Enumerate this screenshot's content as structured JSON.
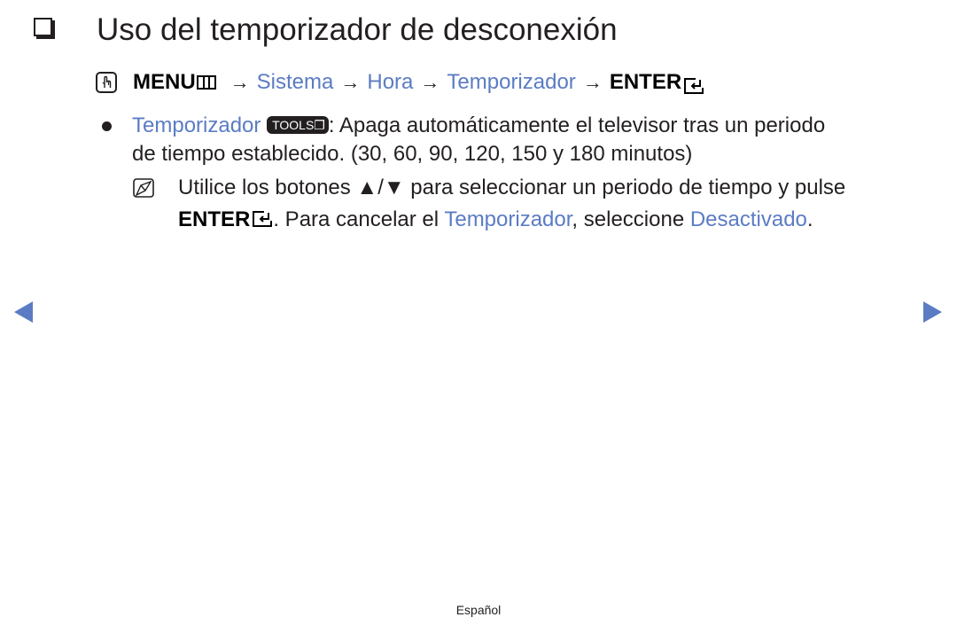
{
  "page": {
    "title": "Uso del temporizador de desconexión",
    "language": "Español"
  },
  "menu_path": {
    "menu_label": "MENU",
    "steps": [
      "Sistema",
      "Hora",
      "Temporizador"
    ],
    "enter_label": "ENTER",
    "arrow": "→"
  },
  "bullet": {
    "term": "Temporizador",
    "tools_label": "TOOLS",
    "line1": ": Apaga automáticamente el televisor tras un periodo",
    "line2": "de tiempo establecido. (30, 60, 90, 120, 150 y 180 minutos)"
  },
  "note": {
    "line1": "Utilice los botones ▲/▼ para seleccionar un periodo de tiempo y pulse",
    "enter_label": "ENTER",
    "line2_a": ". Para cancelar el ",
    "line2_term": "Temporizador",
    "line2_b": ", seleccione ",
    "line2_value": "Desactivado",
    "line2_end": "."
  },
  "colors": {
    "accent": "#5b7cc4",
    "text": "#231f20"
  }
}
